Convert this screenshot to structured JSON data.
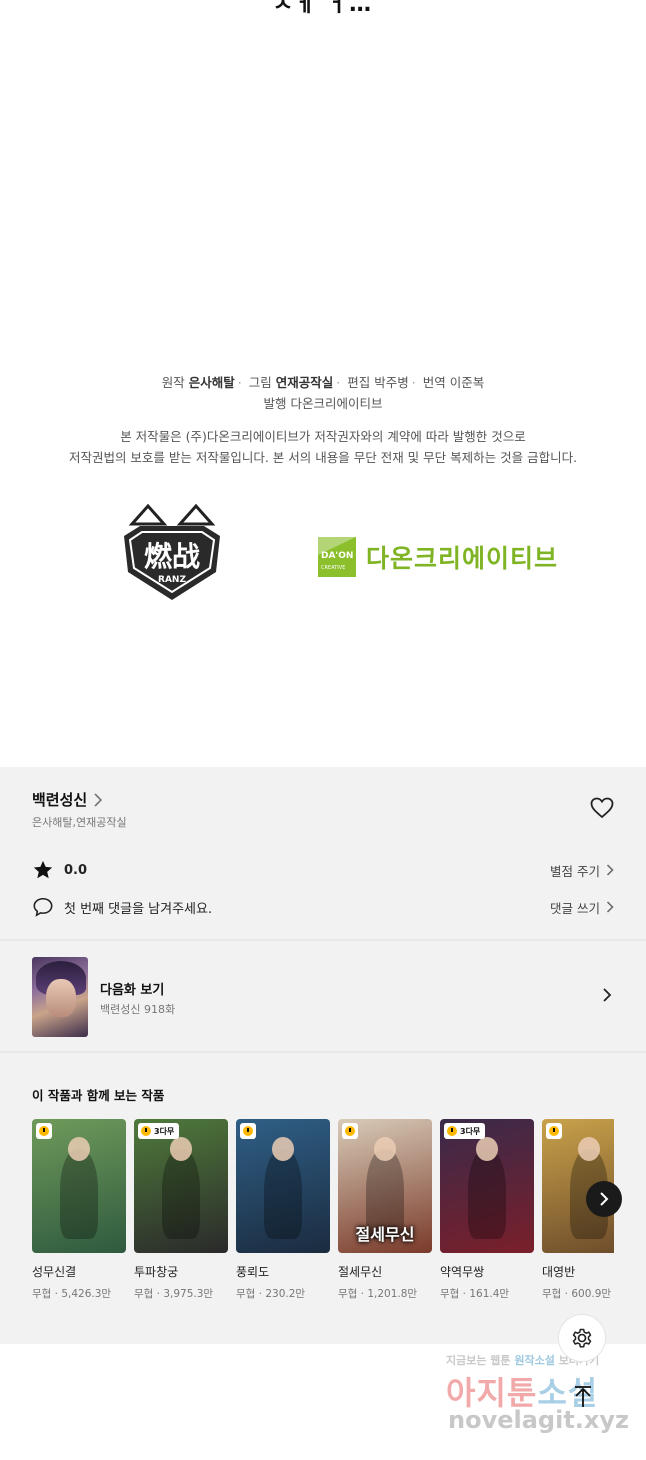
{
  "top_fragment": "ㅅㅔ ㅓ…",
  "credits": {
    "original_label": "원작",
    "original_author": "은사해탈",
    "art_label": "그림",
    "art_author": "연재공작실",
    "editor_label": "편집",
    "editor_name": "박주병",
    "translator_label": "번역",
    "translator_name": "이준복",
    "publisher_label": "발행",
    "publisher_name": "다온크리에이티브"
  },
  "notice": {
    "line1": "본 저작물은 (주)다온크리에이티브가 저작권자와의 계약에 따라 발행한 것으로",
    "line2": "저작권법의 보호를 받는 저작물입니다. 본 서의 내용을 무단 전재 및 무단 복제하는 것을 금합니다."
  },
  "logos": {
    "left_sub": "RANZ",
    "right_box_top": "DA'ON",
    "right_box_bottom": "CREATIVE",
    "right_text": "다온크리에이티브"
  },
  "series": {
    "title": "백련성신",
    "authors": "은사해탈,연재공작실"
  },
  "rating": {
    "value": "0.0",
    "action": "별점 주기"
  },
  "comment": {
    "prompt": "첫 번째 댓글을 남겨주세요.",
    "action": "댓글 쓰기"
  },
  "next_episode": {
    "title": "다음화 보기",
    "subtitle": "백련성신 918화"
  },
  "recommendations": {
    "heading": "이 작품과 함께 보는 작품",
    "items": [
      {
        "name": "성무신결",
        "meta": "무협 · 5,426.3만",
        "badge": "",
        "cover_text": "",
        "colors": [
          "#6f9a5a",
          "#2f5a3f"
        ]
      },
      {
        "name": "투파창궁",
        "meta": "무협 · 3,975.3만",
        "badge": "3다무",
        "cover_text": "",
        "colors": [
          "#4f7a3b",
          "#2a2a2a"
        ]
      },
      {
        "name": "풍뢰도",
        "meta": "무협 · 230.2만",
        "badge": "",
        "cover_text": "",
        "colors": [
          "#2f5f86",
          "#1b2b3f"
        ]
      },
      {
        "name": "절세무신",
        "meta": "무협 · 1,201.8만",
        "badge": "",
        "cover_text": "절세무신",
        "colors": [
          "#d8cbb8",
          "#7a3a2a"
        ]
      },
      {
        "name": "약역무쌍",
        "meta": "무협 · 161.4만",
        "badge": "3다무",
        "cover_text": "",
        "colors": [
          "#3a2a4a",
          "#7a1f2a"
        ]
      },
      {
        "name": "대영반",
        "meta": "무협 · 600.9만",
        "badge": "",
        "cover_text": "",
        "colors": [
          "#c9a24a",
          "#6b4a2a"
        ]
      }
    ]
  },
  "watermark": {
    "line1_a": "지금보는 웹툰",
    "line1_b": "원작소설",
    "line1_c": "보러가기",
    "line2_a": "아지툰",
    "line2_b": "소설",
    "line3": "novelagit.xyz"
  },
  "icons": {
    "heart": "heart-outline-icon",
    "star": "star-icon",
    "comment": "speech-bubble-icon",
    "chevron": "chevron-right-icon",
    "settings": "gear-icon",
    "top": "arrow-up-icon"
  },
  "colors": {
    "panel_bg": "#f2f2f2",
    "daon_green": "#8cbf2c",
    "next_arrow_bg": "#1a1a1a"
  }
}
